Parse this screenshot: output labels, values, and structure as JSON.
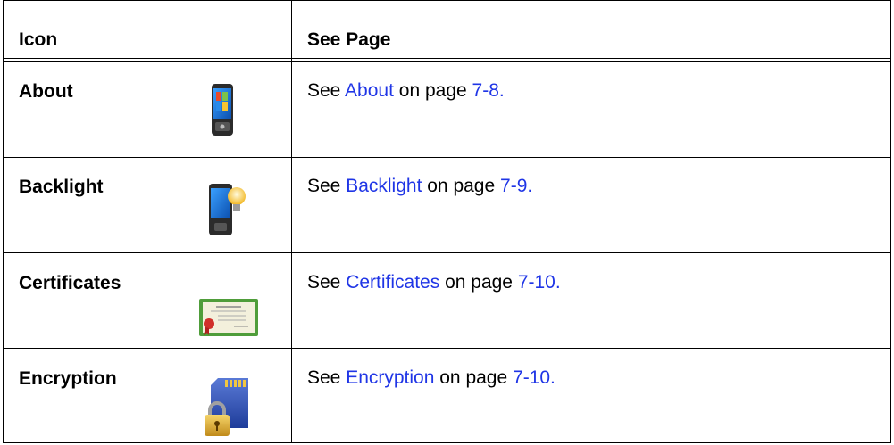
{
  "header": {
    "col1": "Icon",
    "col2": "See Page"
  },
  "rows": [
    {
      "name": "About",
      "see": "See ",
      "link": "About",
      "on_page": " on page ",
      "page": "7-8.",
      "icon": "pda-phone-icon"
    },
    {
      "name": "Backlight",
      "see": "See ",
      "link": "Backlight",
      "on_page": " on page ",
      "page": "7-9.",
      "icon": "backlight-bulb-icon"
    },
    {
      "name": "Certificates",
      "see": "See ",
      "link": "Certificates",
      "on_page": " on page ",
      "page": "7-10.",
      "icon": "certificate-icon"
    },
    {
      "name": "Encryption",
      "see": "See ",
      "link": "Encryption",
      "on_page": " on page ",
      "page": "7-10.",
      "icon": "sd-card-lock-icon"
    }
  ],
  "colors": {
    "link": "#1f35e6",
    "border": "#000000"
  }
}
